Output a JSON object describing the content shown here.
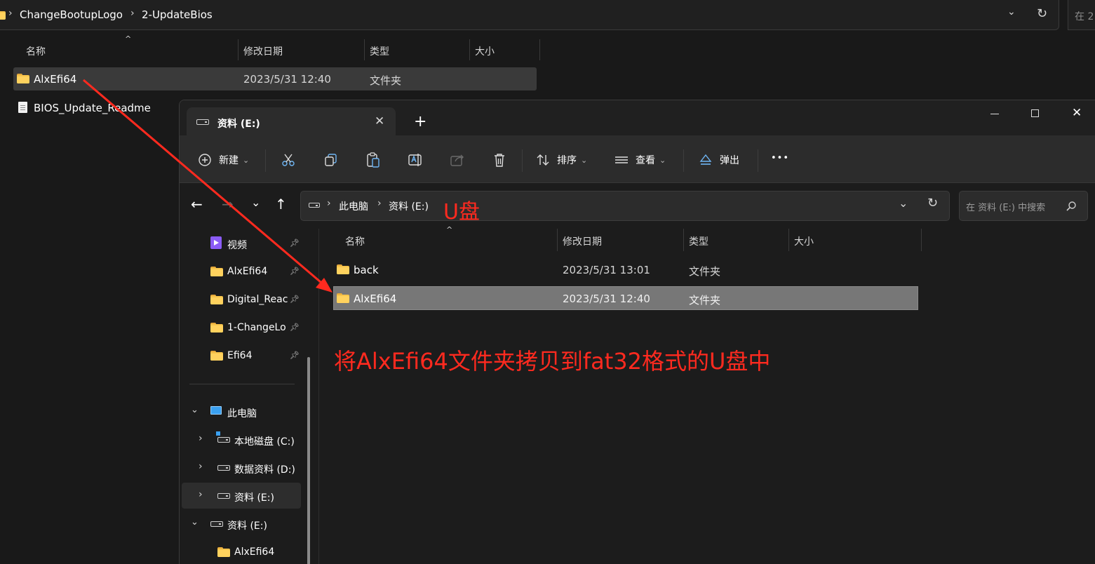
{
  "back_window": {
    "breadcrumb": [
      "ChangeBootupLogo",
      "2-UpdateBios"
    ],
    "search_placeholder": "在 2",
    "columns": [
      "名称",
      "修改日期",
      "类型",
      "大小"
    ],
    "rows": [
      {
        "name": "AlxEfi64",
        "date": "2023/5/31 12:40",
        "type": "文件夹"
      },
      {
        "name": "BIOS_Update_Readme"
      }
    ]
  },
  "front_window": {
    "tab_title": "资料 (E:)",
    "toolbar": {
      "new_label": "新建",
      "sort_label": "排序",
      "view_label": "查看",
      "eject_label": "弹出",
      "more_label": "•••"
    },
    "breadcrumb": [
      "此电脑",
      "资料 (E:)"
    ],
    "search_placeholder": "在 资料 (E:) 中搜索",
    "columns": [
      "名称",
      "修改日期",
      "类型",
      "大小"
    ],
    "rows": [
      {
        "name": "back",
        "date": "2023/5/31 13:01",
        "type": "文件夹"
      },
      {
        "name": "AlxEfi64",
        "date": "2023/5/31 12:40",
        "type": "文件夹"
      }
    ],
    "sidebar": {
      "quick": [
        {
          "label": "视频"
        },
        {
          "label": "AlxEfi64"
        },
        {
          "label": "Digital_Reac"
        },
        {
          "label": "1-ChangeLo"
        },
        {
          "label": "Efi64"
        }
      ],
      "this_pc": "此电脑",
      "drives": [
        "本地磁盘 (C:)",
        "数据资料 (D:)",
        "资料 (E:)"
      ],
      "usb": "资料 (E:)",
      "usb_child": "AlxEfi64"
    }
  },
  "annotations": {
    "usb_label": "U盘",
    "instruction": "将AlxEfi64文件夹拷贝到fat32格式的U盘中",
    "color": "#ff2a1f"
  }
}
